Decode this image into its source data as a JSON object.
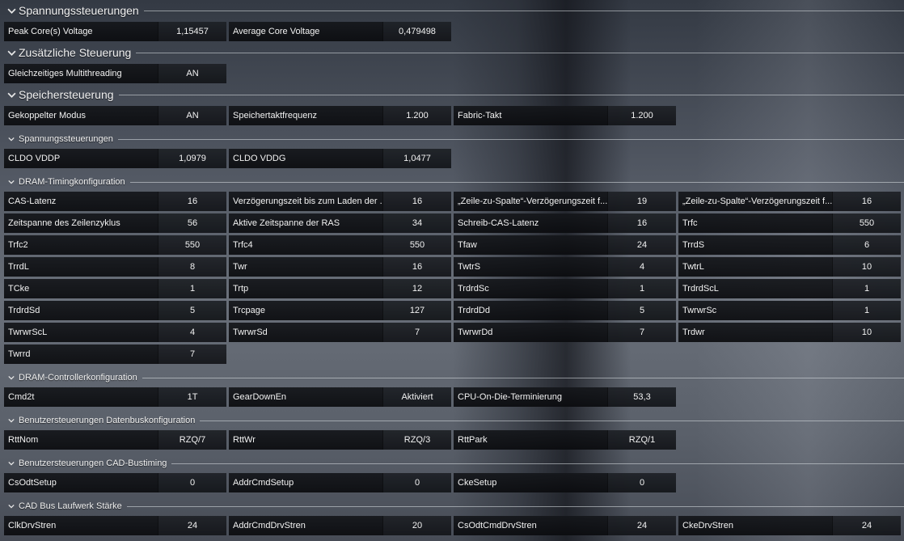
{
  "sections": [
    {
      "key": "s1",
      "title": "Spannungssteuerungen",
      "size": "major",
      "rows": [
        [
          {
            "label": "Peak Core(s) Voltage",
            "value": "1,15457"
          },
          {
            "label": "Average Core Voltage",
            "value": "0,479498"
          }
        ]
      ]
    },
    {
      "key": "s2",
      "title": "Zusätzliche Steuerung",
      "size": "major",
      "rows": [
        [
          {
            "label": "Gleichzeitiges Multithreading",
            "value": "AN"
          }
        ]
      ]
    },
    {
      "key": "s3",
      "title": "Speichersteuerung",
      "size": "major",
      "rows": [
        [
          {
            "label": "Gekoppelter Modus",
            "value": "AN"
          },
          {
            "label": "Speichertaktfrequenz",
            "value": "1.200"
          },
          {
            "label": "Fabric-Takt",
            "value": "1.200"
          }
        ]
      ]
    },
    {
      "key": "s4",
      "title": "Spannungssteuerungen",
      "size": "minor",
      "rows": [
        [
          {
            "label": "CLDO VDDP",
            "value": "1,0979"
          },
          {
            "label": "CLDO VDDG",
            "value": "1,0477"
          }
        ]
      ]
    },
    {
      "key": "s5",
      "title": "DRAM-Timingkonfiguration",
      "size": "minor",
      "rows": [
        [
          {
            "label": "CAS-Latenz",
            "value": "16"
          },
          {
            "label": "Verzögerungszeit bis zum Laden der ...",
            "value": "16"
          },
          {
            "label": "„Zeile-zu-Spalte“-Verzögerungszeit f...",
            "value": "19"
          },
          {
            "label": "„Zeile-zu-Spalte“-Verzögerungszeit f...",
            "value": "16"
          }
        ],
        [
          {
            "label": "Zeitspanne des Zeilenzyklus",
            "value": "56"
          },
          {
            "label": "Aktive Zeitspanne der RAS",
            "value": "34"
          },
          {
            "label": "Schreib-CAS-Latenz",
            "value": "16"
          },
          {
            "label": "Trfc",
            "value": "550"
          }
        ],
        [
          {
            "label": "Trfc2",
            "value": "550"
          },
          {
            "label": "Trfc4",
            "value": "550"
          },
          {
            "label": "Tfaw",
            "value": "24"
          },
          {
            "label": "TrrdS",
            "value": "6"
          }
        ],
        [
          {
            "label": "TrrdL",
            "value": "8"
          },
          {
            "label": "Twr",
            "value": "16"
          },
          {
            "label": "TwtrS",
            "value": "4"
          },
          {
            "label": "TwtrL",
            "value": "10"
          }
        ],
        [
          {
            "label": "TCke",
            "value": "1"
          },
          {
            "label": "Trtp",
            "value": "12"
          },
          {
            "label": "TrdrdSc",
            "value": "1"
          },
          {
            "label": "TrdrdScL",
            "value": "1"
          }
        ],
        [
          {
            "label": "TrdrdSd",
            "value": "5"
          },
          {
            "label": "Trcpage",
            "value": "127"
          },
          {
            "label": "TrdrdDd",
            "value": "5"
          },
          {
            "label": "TwrwrSc",
            "value": "1"
          }
        ],
        [
          {
            "label": "TwrwrScL",
            "value": "4"
          },
          {
            "label": "TwrwrSd",
            "value": "7"
          },
          {
            "label": "TwrwrDd",
            "value": "7"
          },
          {
            "label": "Trdwr",
            "value": "10"
          }
        ],
        [
          {
            "label": "Twrrd",
            "value": "7"
          }
        ]
      ]
    },
    {
      "key": "s6",
      "title": "DRAM-Controllerkonfiguration",
      "size": "minor",
      "rows": [
        [
          {
            "label": "Cmd2t",
            "value": "1T"
          },
          {
            "label": "GearDownEn",
            "value": "Aktiviert"
          },
          {
            "label": "CPU-On-Die-Terminierung",
            "value": "53,3"
          }
        ]
      ]
    },
    {
      "key": "s7",
      "title": "Benutzersteuerungen Datenbuskonfiguration",
      "size": "minor",
      "rows": [
        [
          {
            "label": "RttNom",
            "value": "RZQ/7"
          },
          {
            "label": "RttWr",
            "value": "RZQ/3"
          },
          {
            "label": "RttPark",
            "value": "RZQ/1"
          }
        ]
      ]
    },
    {
      "key": "s8",
      "title": "Benutzersteuerungen CAD-Bustiming",
      "size": "minor",
      "rows": [
        [
          {
            "label": "CsOdtSetup",
            "value": "0"
          },
          {
            "label": "AddrCmdSetup",
            "value": "0"
          },
          {
            "label": "CkeSetup",
            "value": "0"
          }
        ]
      ]
    },
    {
      "key": "s9",
      "title": "CAD Bus Laufwerk Stärke",
      "size": "minor",
      "rows": [
        [
          {
            "label": "ClkDrvStren",
            "value": "24"
          },
          {
            "label": "AddrCmdDrvStren",
            "value": "20"
          },
          {
            "label": "CsOdtCmdDrvStren",
            "value": "24"
          },
          {
            "label": "CkeDrvStren",
            "value": "24"
          }
        ]
      ]
    }
  ]
}
